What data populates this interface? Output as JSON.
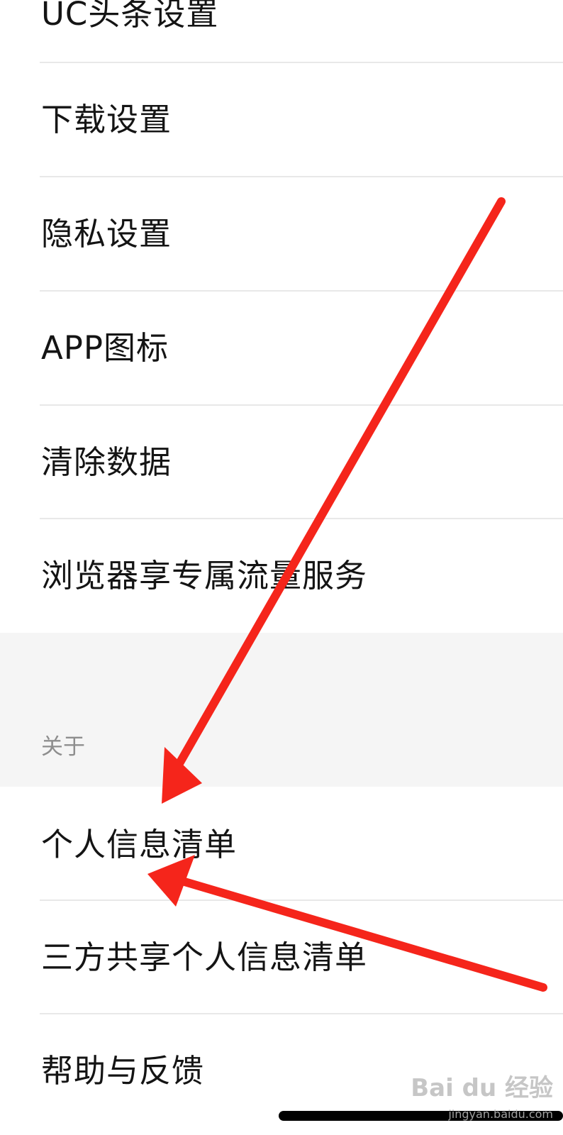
{
  "settings": {
    "top_partial_item": "UC头条设置",
    "items": [
      "下载设置",
      "隐私设置",
      "APP图标",
      "清除数据",
      "浏览器享专属流量服务"
    ]
  },
  "about_section": {
    "header": "关于",
    "items": [
      "个人信息清单",
      "三方共享个人信息清单",
      "帮助与反馈"
    ]
  },
  "watermark": {
    "brand": "Bai du 经验",
    "url": "jingyan.baidu.com"
  },
  "annotation": {
    "arrow_color": "#f5251b"
  }
}
